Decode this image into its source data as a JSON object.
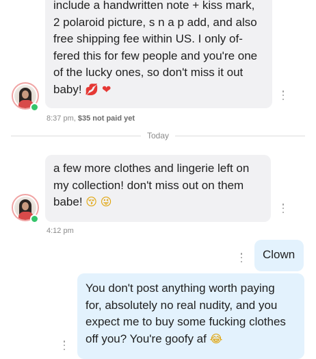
{
  "messages": [
    {
      "lines": [
        "include a handwritten note + kiss mark,",
        "2 polaroid picture, s n a p add, and also",
        "free shipping fee within US. I only of-",
        "fered this for few people and you're one",
        "of the lucky ones, so don't miss it out",
        "baby!"
      ],
      "emojis": [
        "kiss-mark-emoji",
        "red-heart-emoji"
      ],
      "time": "8:37 pm,",
      "status": "$35 not paid yet"
    },
    {
      "lines": [
        "a few more clothes and lingerie left on",
        "my collection! don't miss out on them",
        "babe!"
      ],
      "emojis": [
        "kissing-face-emoji",
        "winking-tongue-emoji"
      ],
      "time": "4:12 pm"
    }
  ],
  "divider": {
    "label": "Today"
  },
  "replies": [
    {
      "text": "Clown"
    },
    {
      "lines": [
        "You don't post anything worth paying",
        "for, absolutely no real nudity, and you",
        "expect me to buy some fucking clothes",
        "off you? You're goofy af"
      ],
      "emojis": [
        "tears-of-joy-emoji"
      ]
    }
  ],
  "colors": {
    "incoming_bubble": "#f1f1f3",
    "outgoing_bubble": "#e3f2fd",
    "online": "#35c46a",
    "meta_text": "#8a8a8a"
  }
}
